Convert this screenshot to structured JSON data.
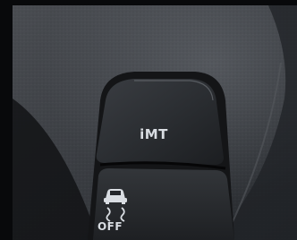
{
  "scene": {
    "kind": "photo",
    "subject": "car-center-console-switch-panel"
  },
  "buttons": [
    {
      "id": "imt",
      "label": "iMT",
      "icon": null
    },
    {
      "id": "traction-control-off",
      "label": "OFF",
      "icon": "skidding-car-icon"
    }
  ],
  "colors": {
    "background": "#0b0c0e",
    "trim": "#3a3d42",
    "button_face": "#2a2d31",
    "label": "#d9dde2"
  }
}
